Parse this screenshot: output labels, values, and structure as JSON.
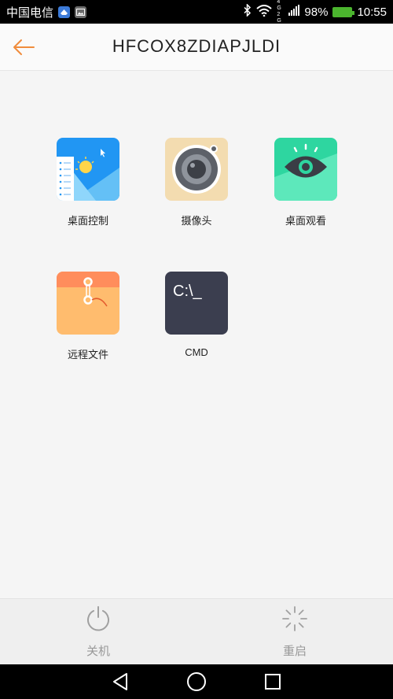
{
  "status_bar": {
    "carrier": "中国电信",
    "signal_label": "4G 2G",
    "battery_percent": "98%",
    "time": "10:55"
  },
  "header": {
    "title": "HFCOX8ZDIAPJLDI"
  },
  "grid": {
    "items": [
      {
        "label": "桌面控制",
        "icon": "desktop-control-icon"
      },
      {
        "label": "摄像头",
        "icon": "camera-icon"
      },
      {
        "label": "桌面观看",
        "icon": "eye-icon"
      },
      {
        "label": "远程文件",
        "icon": "folder-icon"
      },
      {
        "label": "CMD",
        "icon": "terminal-icon",
        "icon_text": "C:\\_"
      }
    ]
  },
  "actions": {
    "shutdown_label": "关机",
    "restart_label": "重启"
  },
  "colors": {
    "accent": "#f08c3c",
    "desktop_blue": "#2196f3",
    "camera_bg": "#f3dcb0",
    "eye_green": "#2ed6a0",
    "folder_orange": "#ffbc6e",
    "cmd_dark": "#3b3e4f"
  }
}
